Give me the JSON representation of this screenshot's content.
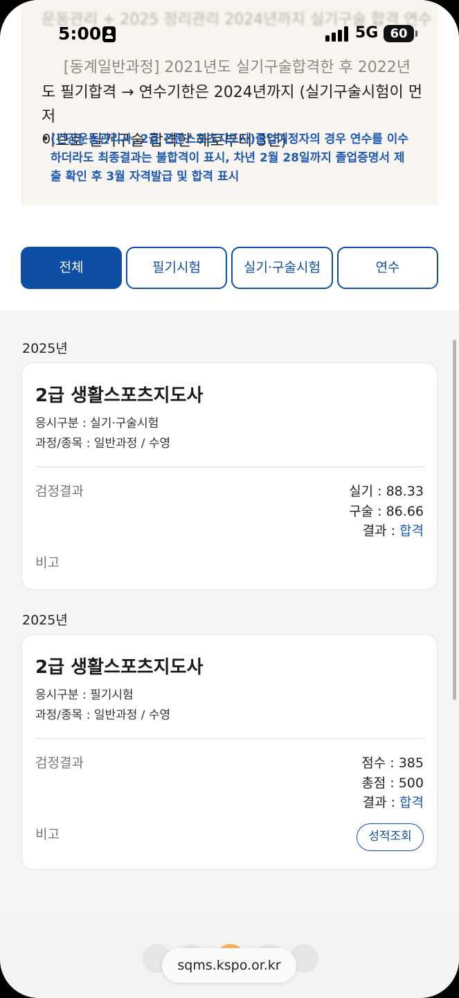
{
  "status_bar": {
    "time": "5:00",
    "network": "5G",
    "battery": "60"
  },
  "notice": {
    "faded_line": "운동관리 + 2025 정리관리 2024년까지 실기구술 합격 연수",
    "line1": "[동계일반과정] 2021년도 실기구술합격한 후 2022년",
    "line2": "도 필기합격 → 연수기한은 2024년까지 (실기구술시험이 먼저",
    "line3": "이므로 실기구술 합격한 해로부터 3년)",
    "bullet": "(건강운동관리사, 2급 전문스포츠지도사)졸업예정자의 경우 연수를 이수하더라도 최종결과는 불합격이 표시, 차년 2월 28일까지 졸업증명서 제출 확인 후 3월 자격발급 및 합격 표시"
  },
  "tabs": [
    "전체",
    "필기시험",
    "실기·구술시험",
    "연수"
  ],
  "results": [
    {
      "year": "2025년",
      "title": "2급 생활스포츠지도사",
      "type": "응시구분 : 실기·구술시험",
      "course": "과정/종목 : 일반과정 / 수영",
      "result_label": "검정결과",
      "score1": "실기 : 88.33",
      "score2": "구술 : 86.66",
      "result_prefix": "결과 : ",
      "result_value": "합격",
      "remark_label": "비고"
    },
    {
      "year": "2025년",
      "title": "2급 생활스포츠지도사",
      "type": "응시구분 : 필기시험",
      "course": "과정/종목 : 일반과정 / 수영",
      "result_label": "검정결과",
      "score1": "점수 : 385",
      "score2": "총점 : 500",
      "result_prefix": "결과 : ",
      "result_value": "합격",
      "remark_label": "비고",
      "button": "성적조회"
    }
  ],
  "browser": {
    "url": "sqms.kspo.or.kr"
  },
  "colors": {
    "primary": "#0e4ea5",
    "pass": "#1f59b6",
    "notice_bg": "#f8f4ef"
  }
}
